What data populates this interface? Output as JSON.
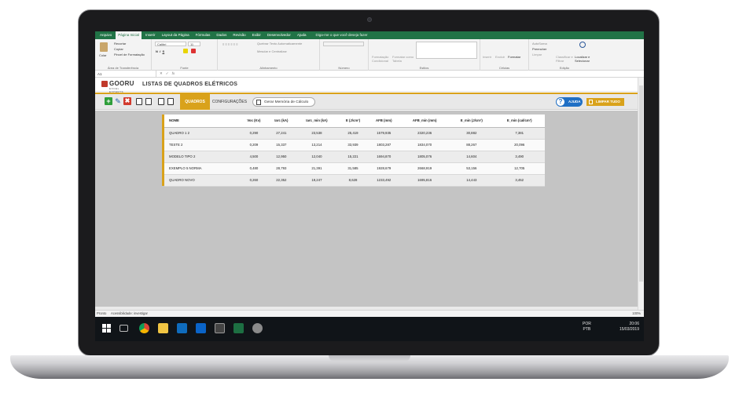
{
  "menu_tabs": [
    "Arquivo",
    "Página Inicial",
    "Inserir",
    "Layout da Página",
    "Fórmulas",
    "Dados",
    "Revisão",
    "Exibir",
    "Desenvolvedor",
    "Ajuda"
  ],
  "tell_me": "Diga-me o que você deseja fazer",
  "ribbon": {
    "clipboard": {
      "paste": "Colar",
      "cut": "Recortar",
      "copy": "Copiar",
      "painter": "Pincel de Formatação",
      "label": "Área de Transferência"
    },
    "font": {
      "name": "Calibri",
      "size": "11",
      "label": "Fonte"
    },
    "alignment": {
      "wrap": "Quebrar Texto Automaticamente",
      "merge": "Mesclar e Centralizar",
      "label": "Alinhamento"
    },
    "number": {
      "label": "Número"
    },
    "styles": {
      "cond": "Formatação Condicional",
      "table": "Formatar como Tabela",
      "label": "Estilos"
    },
    "cells": {
      "insert": "Inserir",
      "delete": "Excluir",
      "format": "Formatar",
      "label": "Células"
    },
    "editing": {
      "autosum": "AutoSoma",
      "fill": "Preencher",
      "clear": "Limpar",
      "sort": "Classificar e Filtrar",
      "find": "Localizar e Selecionar",
      "label": "Edição"
    }
  },
  "name_box": "A1",
  "app": {
    "logo": "GOORU",
    "logo_sub": "EXCEL EXPERTS",
    "title": "LISTAS DE QUADROS ELÉTRICOS",
    "tab_quadros": "QUADROS",
    "tab_config": "CONFIGURAÇÕES",
    "generate_btn": "Gerar Memória de Cálculo",
    "help_btn": "AJUDA",
    "clear_btn": "LIMPAR TUDO"
  },
  "table": {
    "headers": [
      "NOME",
      "Voc (Kv)",
      "Iarc (kA)",
      "Iarc_min (kA)",
      "E (J/cm²)",
      "AFB (mm)",
      "AFB_min (mm)",
      "E_min (J/cm²)",
      "E_min (cal/cm²)"
    ],
    "rows": [
      [
        "QUADRO 1 2",
        "0,290",
        "27,241",
        "23,538",
        "25,419",
        "1579,935",
        "2320,236",
        "30,882",
        "7,381"
      ],
      [
        "TESTE 2",
        "0,209",
        "15,337",
        "13,214",
        "33,939",
        "1803,287",
        "1834,070",
        "88,267",
        "20,096"
      ],
      [
        "MODELO TIPO 2",
        "4,500",
        "12,950",
        "12,040",
        "15,221",
        "1694,870",
        "1805,076",
        "14,604",
        "3,490"
      ],
      [
        "EXEMPLO 5 NORMA",
        "0,480",
        "28,793",
        "21,391",
        "31,585",
        "1928,679",
        "2668,919",
        "53,156",
        "12,705"
      ],
      [
        "QUADRO NOVO",
        "0,260",
        "22,352",
        "19,247",
        "8,628",
        "1233,492",
        "1695,816",
        "14,443",
        "3,452"
      ]
    ]
  },
  "status": {
    "mode": "Pronto",
    "accessibility": "Acessibilidade: investigar",
    "zoom": "100%"
  },
  "taskbar": {
    "lang1": "POR",
    "lang2": "PTB",
    "time": "20:06",
    "date": "15/03/2019"
  }
}
